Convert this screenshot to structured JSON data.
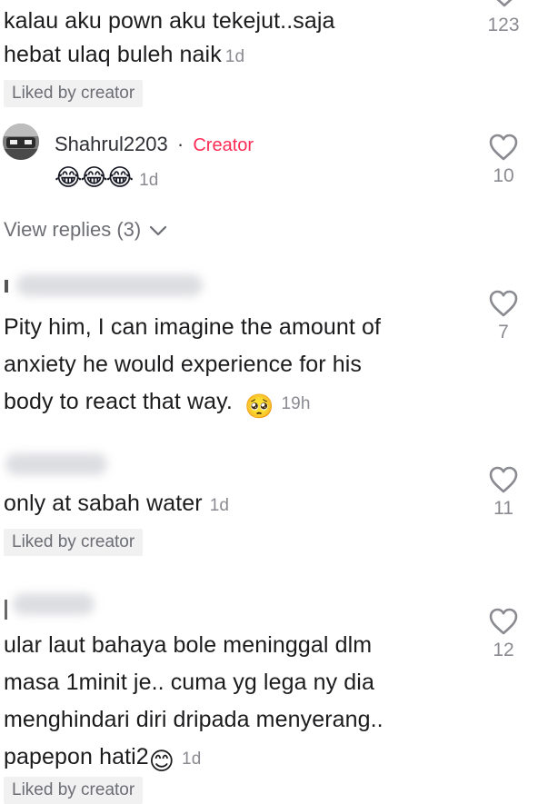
{
  "comments": [
    {
      "lines": [
        "kalau aku pown aku tekejut..saja",
        "hebat ulaq buleh naik"
      ],
      "time": "1d",
      "badge": "Liked by creator",
      "likes": "123"
    },
    {
      "username": "Shahrul2203",
      "separator": "·",
      "role": "Creator",
      "emoji": "😂😂😂",
      "time": "1d",
      "likes": "10",
      "view_replies": "View replies (3)"
    },
    {
      "lines": [
        "Pity him, I can imagine the amount of",
        "anxiety he would experience for his",
        "body to react that way."
      ],
      "emoji": "🥺",
      "time": "19h",
      "likes": "7"
    },
    {
      "lines": [
        "only at sabah water"
      ],
      "time": "1d",
      "badge": "Liked by creator",
      "likes": "11"
    },
    {
      "lines": [
        "ular laut bahaya bole meninggal dlm",
        "masa 1minit je.. cuma yg lega ny dia",
        "menghindari diri dripada menyerang..",
        "papepon hati2"
      ],
      "emoji": "😊",
      "time": "1d",
      "badge": "Liked by creator",
      "likes": "12"
    }
  ],
  "colors": {
    "creator_accent": "#fe2c55",
    "muted_text": "#8a8b91",
    "badge_bg": "#f1f1f2"
  },
  "icons": [
    "heart-outline-icon",
    "chevron-down-icon"
  ]
}
